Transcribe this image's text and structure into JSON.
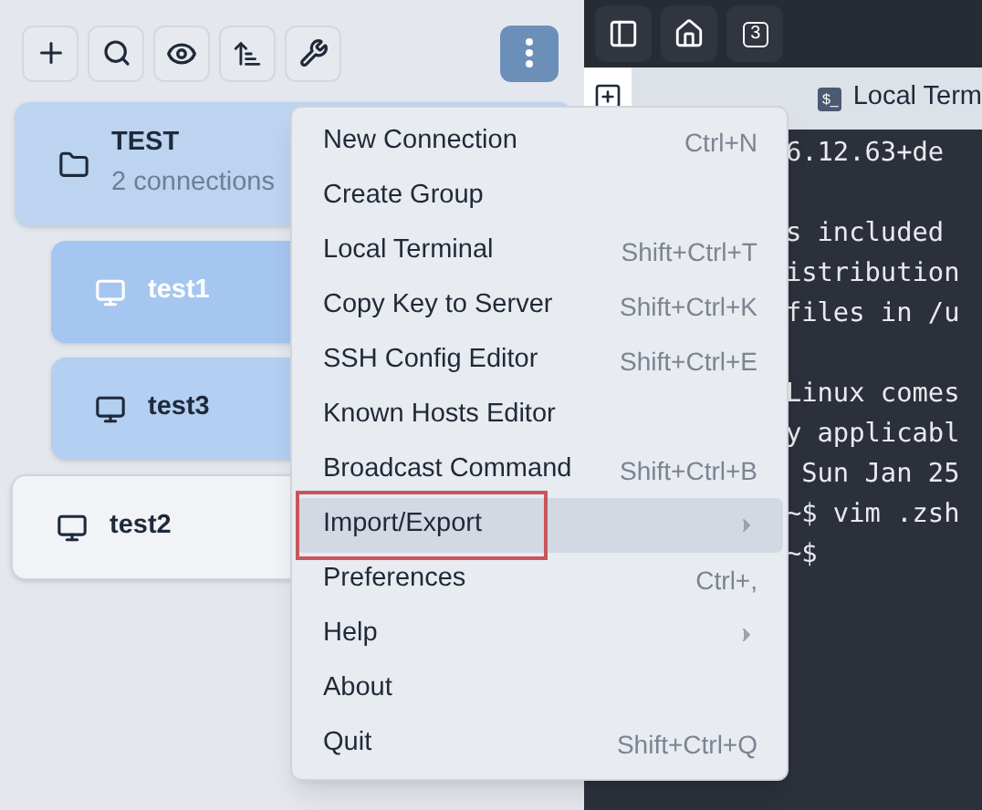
{
  "toolbar": {
    "more_button_active": true
  },
  "sidebar": {
    "items": [
      {
        "name": "TEST",
        "subtitle": "2 connections",
        "kind": "group",
        "selected": false,
        "children": [
          {
            "name": "test1",
            "kind": "host",
            "selected": true
          },
          {
            "name": "test3",
            "kind": "host",
            "selected": false
          }
        ]
      },
      {
        "name": "test2",
        "kind": "host",
        "selected": false
      }
    ]
  },
  "header": {
    "tab_count": "3"
  },
  "tab": {
    "icon_text": "$_",
    "label": "Local Term"
  },
  "terminal": {
    "blocks": [
      {
        "lines": [
          "6.12.63+de"
        ]
      },
      {
        "lines": [
          "s included",
          "istribution",
          "files in /u"
        ]
      },
      {
        "lines": [
          "Linux comes",
          "y applicabl",
          " Sun Jan 25",
          "~$ vim .zsh",
          "~$"
        ]
      }
    ]
  },
  "menu": {
    "items": [
      {
        "label": "New Connection",
        "shortcut": "Ctrl+N",
        "submenu": false,
        "highlighted": false,
        "annotated": false
      },
      {
        "label": "Create Group",
        "submenu": false,
        "highlighted": false,
        "annotated": false
      },
      {
        "label": "Local Terminal",
        "shortcut": "Shift+Ctrl+T",
        "submenu": false,
        "highlighted": false,
        "annotated": false
      },
      {
        "label": "Copy Key to Server",
        "shortcut": "Shift+Ctrl+K",
        "submenu": false,
        "highlighted": false,
        "annotated": false
      },
      {
        "label": "SSH Config Editor",
        "shortcut": "Shift+Ctrl+E",
        "submenu": false,
        "highlighted": false,
        "annotated": false
      },
      {
        "label": "Known Hosts Editor",
        "submenu": false,
        "highlighted": false,
        "annotated": false
      },
      {
        "label": "Broadcast Command",
        "shortcut": "Shift+Ctrl+B",
        "submenu": false,
        "highlighted": false,
        "annotated": false
      },
      {
        "label": "Import/Export",
        "submenu": true,
        "highlighted": true,
        "annotated": true
      },
      {
        "label": "Preferences",
        "shortcut": "Ctrl+,",
        "submenu": false,
        "highlighted": false,
        "annotated": false
      },
      {
        "label": "Help",
        "submenu": true,
        "highlighted": false,
        "annotated": false
      },
      {
        "label": "About",
        "submenu": false,
        "highlighted": false,
        "annotated": false
      },
      {
        "label": "Quit",
        "shortcut": "Shift+Ctrl+Q",
        "submenu": false,
        "highlighted": false,
        "annotated": false
      }
    ]
  }
}
